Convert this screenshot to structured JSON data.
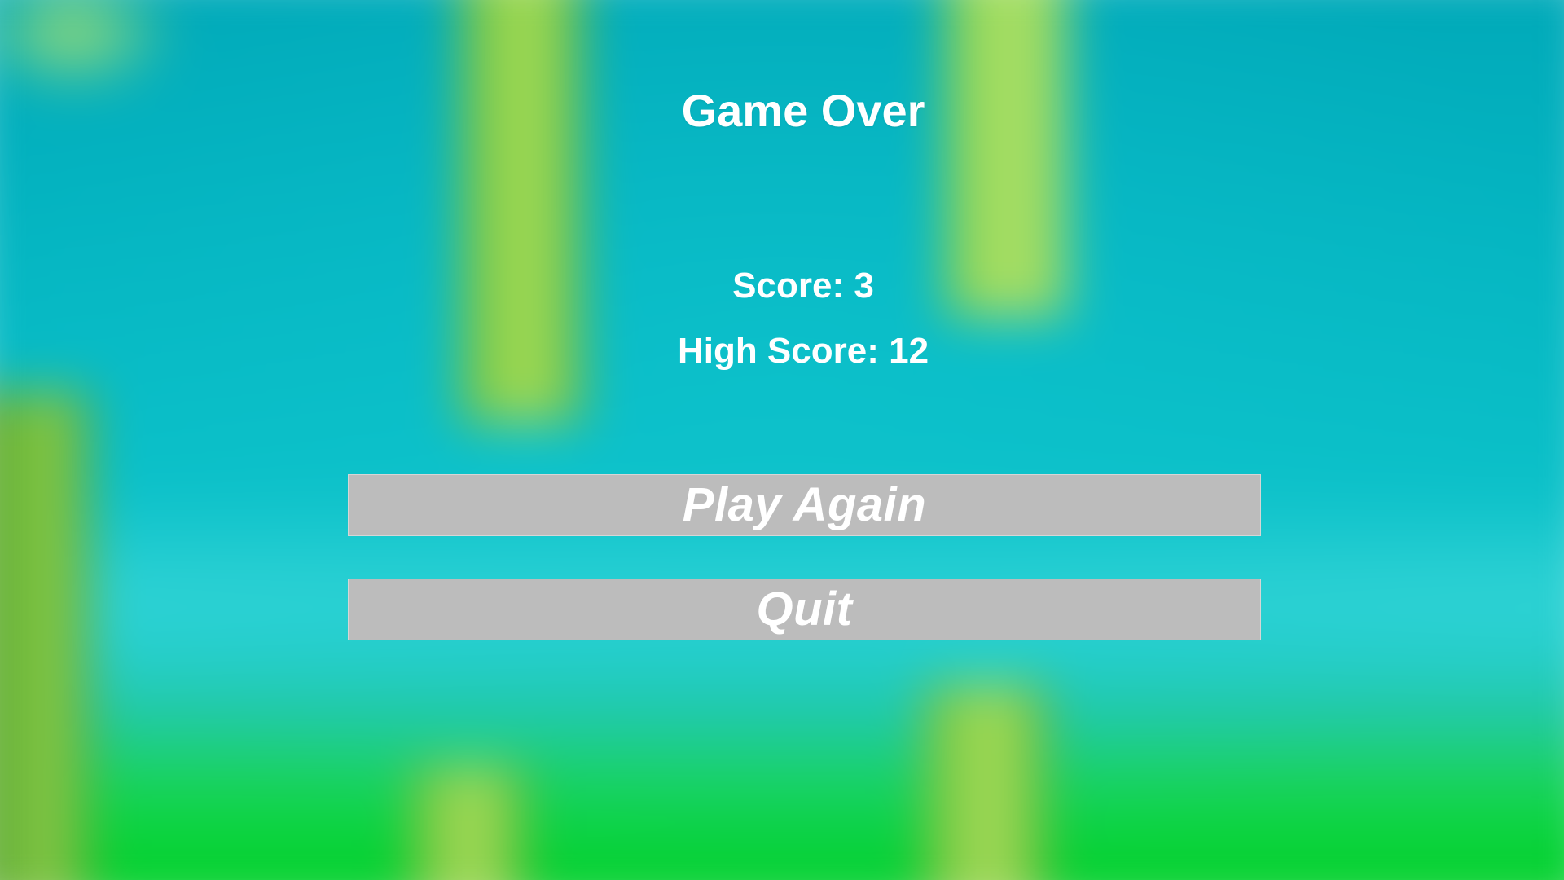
{
  "game_over_screen": {
    "title": "Game Over",
    "score_label": "Score:",
    "score_value": "3",
    "high_score_label": "High Score:",
    "high_score_value": "12",
    "buttons": {
      "play_again": "Play Again",
      "quit": "Quit"
    }
  },
  "colors": {
    "sky": "#00a8b8",
    "ground": "#04d028",
    "pipe": "#8ed24b",
    "button_fill": "#bcbcbc",
    "text": "#ffffff"
  },
  "background_elements": [
    "blurred-sky",
    "blurred-pipes",
    "blurred-ground"
  ]
}
